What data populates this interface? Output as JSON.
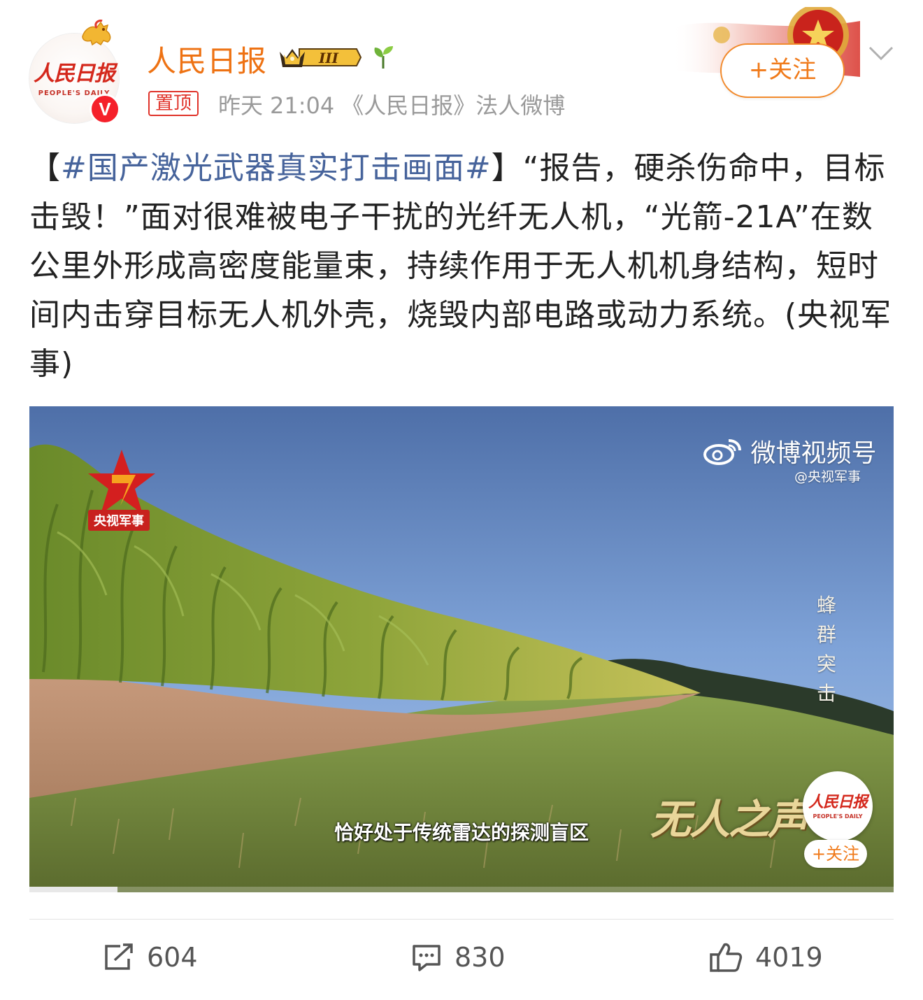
{
  "account": {
    "name": "人民日报",
    "avatar_text": "人民日报",
    "avatar_sub": "PEOPLE'S DAILY",
    "verified_mark": "V",
    "vip_level": "III",
    "pinned_tag": "置顶",
    "post_day": "昨天",
    "post_time": "21:04",
    "source": "《人民日报》法人微博",
    "follow_label": "+关注"
  },
  "post": {
    "bracket_open": "【",
    "hashtag": "#国产激光武器真实打击画面#",
    "bracket_close": "】",
    "body": "“报告，硬杀伤命中，目标击毁！”面对很难被电子干扰的光纤无人机，“光箭-21A”在数公里外形成高密度能量束，持续作用于无人机机身结构，短时间内击穿目标无人机外壳，烧毁内部电路或动力系统。(央视军事)"
  },
  "video": {
    "channel_logo_label": "央视军事",
    "brand": "微博视频号",
    "handle": "@央视军事",
    "vertical_caption": [
      "蜂",
      "群",
      "突",
      "击"
    ],
    "program_title": "无人之声",
    "subtitle": "恰好处于传统雷达的探测盲区",
    "overlay_logo_text": "人民日报",
    "overlay_logo_sub": "PEOPLE'S DAILY",
    "overlay_follow_label": "+关注",
    "progress_fraction": 0.102
  },
  "actions": {
    "repost_count": "604",
    "comment_count": "830",
    "like_count": "4019"
  },
  "colors": {
    "username": "#ee7213",
    "hashtag": "#46639b",
    "follow": "#f07a1a",
    "pin": "#e0332a"
  },
  "icons": [
    "repost-icon",
    "comment-icon",
    "like-icon",
    "chevron-down-icon",
    "weibo-icon",
    "sprout-icon",
    "crown-icon"
  ]
}
